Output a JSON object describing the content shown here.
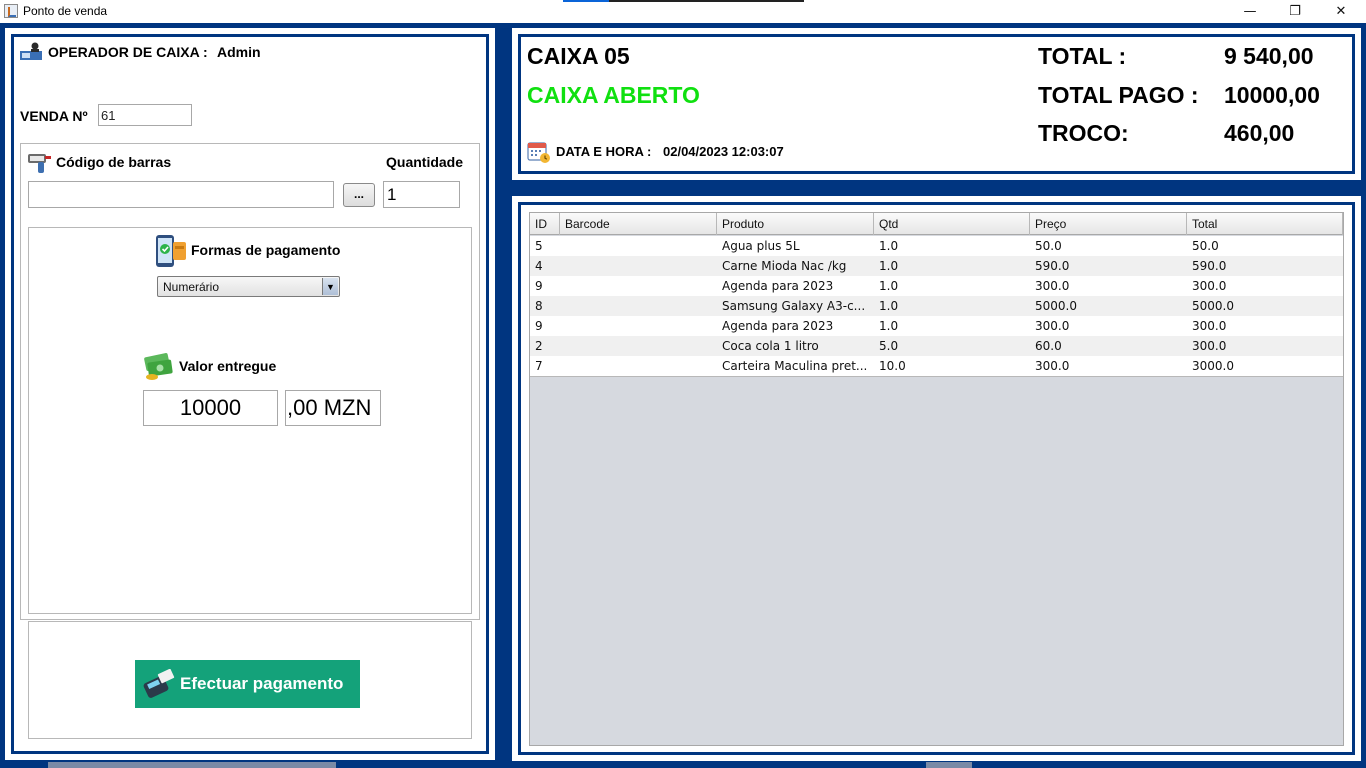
{
  "window": {
    "title": "Ponto de venda",
    "minimize": "—",
    "maximize": "❐",
    "close": "✕"
  },
  "operator": {
    "label": "OPERADOR DE CAIXA :",
    "name": "Admin"
  },
  "sale": {
    "label": "VENDA Nº",
    "number": "61"
  },
  "barcode": {
    "label": "Código de barras",
    "value": "",
    "browse_label": "...",
    "qty_label": "Quantidade",
    "qty_value": "1"
  },
  "payment": {
    "label": "Formas de pagamento",
    "method": "Numerário",
    "amount_label": "Valor entregue",
    "amount": "10000",
    "amount_suffix": ",00 MZN",
    "button_label": "Efectuar pagamento"
  },
  "register": {
    "name": "CAIXA 05",
    "status": "CAIXA ABERTO",
    "status_color": "#10e010",
    "datetime_label": "DATA E HORA :",
    "datetime_value": "02/04/2023  12:03:07"
  },
  "totals": {
    "total_label": "TOTAL :",
    "total_value": "9 540,00",
    "paid_label": "TOTAL PAGO :",
    "paid_value": "10000,00",
    "change_label": "TROCO:",
    "change_value": "460,00"
  },
  "table": {
    "columns": [
      "ID",
      "Barcode",
      "Produto",
      "Qtd",
      "Preço",
      "Total"
    ],
    "rows": [
      [
        "5",
        "",
        "Agua plus 5L",
        "1.0",
        "50.0",
        "50.0"
      ],
      [
        "4",
        "",
        "Carne Mioda Nac /kg",
        "1.0",
        "590.0",
        "590.0"
      ],
      [
        "9",
        "",
        "Agenda para 2023",
        "1.0",
        "300.0",
        "300.0"
      ],
      [
        "8",
        "",
        "Samsung Galaxy A3-c...",
        "1.0",
        "5000.0",
        "5000.0"
      ],
      [
        "9",
        "",
        "Agenda para 2023",
        "1.0",
        "300.0",
        "300.0"
      ],
      [
        "2",
        "",
        "Coca cola 1 litro",
        "5.0",
        "60.0",
        "300.0"
      ],
      [
        "7",
        "",
        "Carteira Maculina pret...",
        "10.0",
        "300.0",
        "3000.0"
      ]
    ]
  },
  "colors": {
    "frame": "#003580",
    "pay_button": "#14a27a"
  }
}
